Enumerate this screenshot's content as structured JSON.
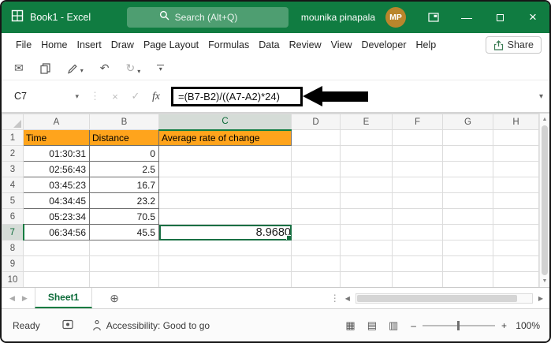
{
  "colors": {
    "excel_green": "#107C41",
    "header_fill": "#FFA41C",
    "selection_green": "#1A7044",
    "avatar_gold": "#B9862C"
  },
  "title_bar": {
    "title": "Book1  -  Excel",
    "search_placeholder": "Search (Alt+Q)",
    "user_name": "mounika pinapala",
    "user_initials": "MP"
  },
  "ribbon": {
    "tabs": [
      "File",
      "Home",
      "Insert",
      "Draw",
      "Page Layout",
      "Formulas",
      "Data",
      "Review",
      "View",
      "Developer",
      "Help"
    ],
    "share_label": "Share"
  },
  "formula_bar": {
    "name_box": "C7",
    "fx_label": "fx",
    "formula": "=(B7-B2)/((A7-A2)*24)"
  },
  "grid": {
    "columns": [
      "A",
      "B",
      "C",
      "D",
      "E",
      "F",
      "G",
      "H"
    ],
    "row_numbers": [
      "1",
      "2",
      "3",
      "4",
      "5",
      "6",
      "7",
      "8",
      "9",
      "10"
    ],
    "selected_cell": "C7",
    "selected_column": "C",
    "selected_row": "7",
    "cells": {
      "A1": "Time",
      "B1": "Distance",
      "C1": "Average rate of change",
      "A2": "01:30:31",
      "B2": "0",
      "A3": "02:56:43",
      "B3": "2.5",
      "A4": "03:45:23",
      "B4": "16.7",
      "A5": "04:34:45",
      "B5": "23.2",
      "A6": "05:23:34",
      "B6": "70.5",
      "A7": "06:34:56",
      "B7": "45.5",
      "C7": "8.9680"
    }
  },
  "sheet_bar": {
    "active_tab": "Sheet1"
  },
  "status_bar": {
    "mode": "Ready",
    "accessibility": "Accessibility: Good to go",
    "zoom_level": "100%"
  },
  "icons": {
    "minimize": "—",
    "close": "×",
    "dropdown": "▾",
    "email": "✉",
    "undo": "↶",
    "redo": "↻",
    "cancel": "×",
    "check": "✓",
    "prev_sheet": "◀",
    "next_sheet": "▶",
    "add_sheet": "⊕",
    "dots": "⋮",
    "view_normal": "▦",
    "view_page_layout": "▤",
    "view_page_break": "▥",
    "zoom_out": "–",
    "zoom_in": "+",
    "scroll_up": "▲",
    "scroll_down": "▼"
  }
}
